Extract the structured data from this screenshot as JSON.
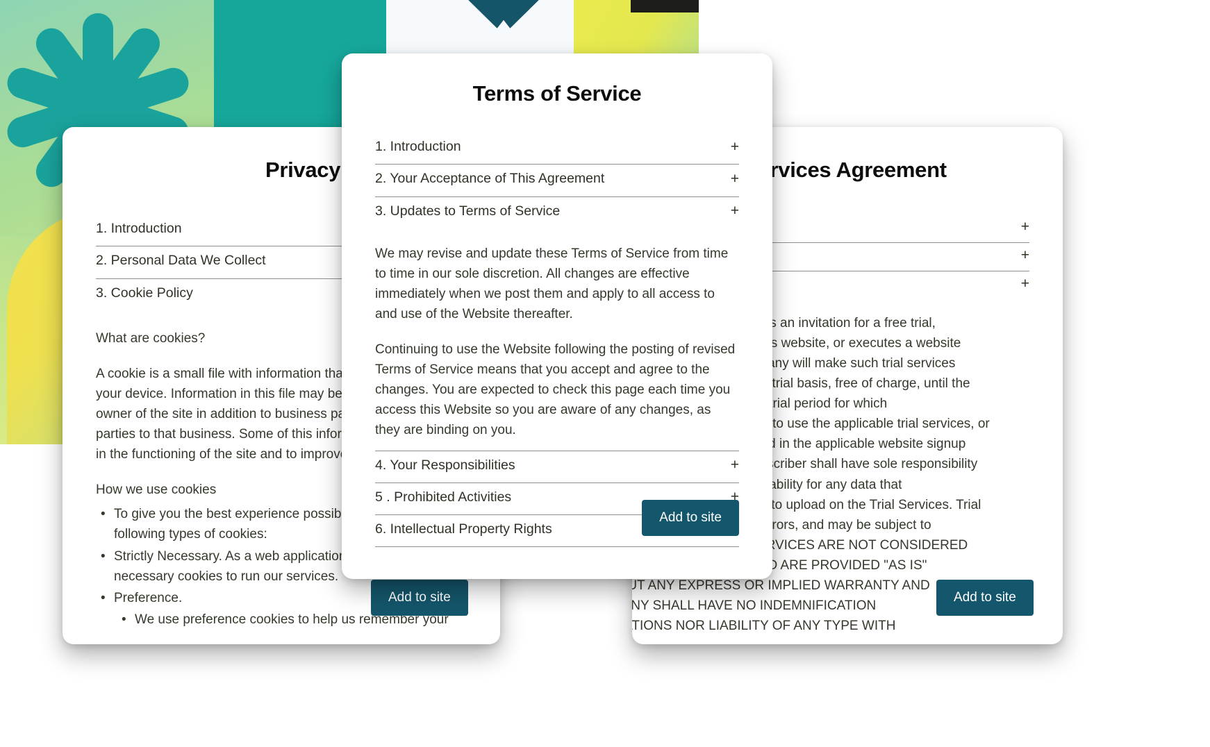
{
  "background": {
    "colors": {
      "teal_block": "#16a79b",
      "green_gradient_start": "#8fd4b4",
      "green_gradient_end": "#b9e08d",
      "yellow": "#e9ea4e",
      "navy_star": "#14556a",
      "accent_button": "#14566b"
    },
    "shapes": {
      "asterisk_icon": "asterisk-flower",
      "starburst_icon": "starburst"
    }
  },
  "cards": {
    "privacy": {
      "title": "Privacy Policy",
      "sections": [
        {
          "label": "1. Introduction",
          "expand_icon": "+"
        },
        {
          "label": "2. Personal Data We Collect",
          "expand_icon": "+"
        },
        {
          "label": "3. Cookie Policy",
          "expand_icon": "+"
        }
      ],
      "body": {
        "heading": "What are cookies?",
        "paragraph": "A cookie is a small file with information that a website stores on your device. Information in this file may be shared with the owner of the site in addition to business partners and third parties to that business. Some of this information may be used in the functioning of the site and to improve your experience.",
        "list_heading": "How we use cookies",
        "bullets": [
          "To give you the best experience possible, we use the following types of cookies:",
          "Strictly Necessary. As a web application, we require certain necessary cookies to run our services.",
          "Preference."
        ],
        "sub_bullets": [
          "We use preference cookies to help us remember your"
        ]
      },
      "button": "Add to site"
    },
    "terms": {
      "title": "Terms of Service",
      "sections_top": [
        {
          "label": "1. Introduction",
          "expand_icon": "+"
        },
        {
          "label": "2. Your Acceptance of This Agreement",
          "expand_icon": "+"
        },
        {
          "label": "3. Updates to Terms of Service",
          "expand_icon": "+"
        }
      ],
      "body_paragraphs": [
        "We may revise and update these Terms of Service from time to time in our sole discretion. All changes are effective immediately when we post them and apply to all access to and use of the Website thereafter.",
        "Continuing to use the Website following the posting of revised Terms of Service means that you accept and agree to the changes. You are expected to check this page each time you access this Website so you are aware of any changes, as they are binding on you."
      ],
      "sections_bottom": [
        {
          "label": "4. Your Responsibilities",
          "expand_icon": "+"
        },
        {
          "label": "5 .  Prohibited Activities",
          "expand_icon": "+"
        },
        {
          "label": "6. Intellectual Property Rights",
          "expand_icon": "+"
        }
      ],
      "button": "Add to site"
    },
    "subscription": {
      "title": "Subscription Services Agreement",
      "title_visible": "tion Services Agreement",
      "sections": [
        {
          "expand_icon": "+"
        },
        {
          "expand_icon": "+"
        },
        {
          "expand_icon": "+"
        }
      ],
      "body_lines": [
        "If Subscriber registers or accepts an invitation for a free trial,",
        "as made available on Company's website, or executes a website",
        "signup form to the same, Company will make such trial services",
        "available to the Subscriber on a trial basis, free of charge, until the",
        "earlier of (a) the end of the free trial period for which",
        "Subscriber registered or offered to use the applicable trial services, or",
        "(b) the start date of any specified in the applicable website signup",
        "page (the \"Trial Services\"). Subscriber shall have sole responsibility",
        "for and Company assumes no liability for any data that",
        "Subscriber may elect to choose to upload on the Trial Services. Trial",
        "Services may contain bugs or errors, and may be subject to",
        "additional risks. THE TRIAL SERVICES ARE NOT CONSIDERED",
        "\"SERVICES\" HEREUNDER AND ARE PROVIDED \"AS IS\"",
        "WITHOUT ANY EXPRESS OR IMPLIED WARRANTY AND",
        "COMPANY SHALL HAVE NO INDEMNIFICATION",
        "OBLIGATIONS NOR LIABILITY OF ANY TYPE WITH"
      ],
      "button": "Add to site"
    }
  }
}
